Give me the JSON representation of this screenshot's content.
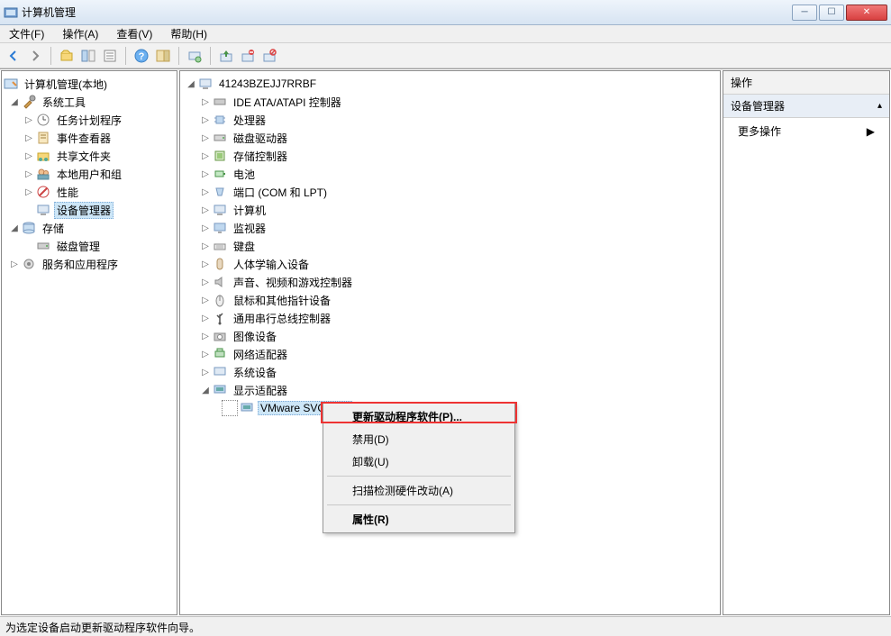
{
  "window": {
    "title": "计算机管理"
  },
  "menu": {
    "file": "文件(F)",
    "action": "操作(A)",
    "view": "查看(V)",
    "help": "帮助(H)"
  },
  "leftTree": {
    "root": "计算机管理(本地)",
    "systools": "系统工具",
    "tasksched": "任务计划程序",
    "eventviewer": "事件查看器",
    "shared": "共享文件夹",
    "localusers": "本地用户和组",
    "perf": "性能",
    "devmgr": "设备管理器",
    "storage": "存储",
    "diskmgmt": "磁盘管理",
    "services": "服务和应用程序"
  },
  "centerTree": {
    "computer": "41243BZEJJ7RRBF",
    "ide": "IDE ATA/ATAPI 控制器",
    "cpu": "处理器",
    "diskdrv": "磁盘驱动器",
    "storctrl": "存储控制器",
    "battery": "电池",
    "ports": "端口 (COM 和 LPT)",
    "computers": "计算机",
    "monitors": "监视器",
    "keyboards": "键盘",
    "hid": "人体学输入设备",
    "sound": "声音、视频和游戏控制器",
    "mouse": "鼠标和其他指针设备",
    "usb": "通用串行总线控制器",
    "imaging": "图像设备",
    "network": "网络适配器",
    "system": "系统设备",
    "display": "显示适配器",
    "vmware": "VMware SVGA 3D"
  },
  "contextMenu": {
    "update": "更新驱动程序软件(P)...",
    "disable": "禁用(D)",
    "uninstall": "卸载(U)",
    "scan": "扫描检测硬件改动(A)",
    "properties": "属性(R)"
  },
  "actions": {
    "header": "操作",
    "title": "设备管理器",
    "more": "更多操作"
  },
  "status": "为选定设备启动更新驱动程序软件向导。"
}
